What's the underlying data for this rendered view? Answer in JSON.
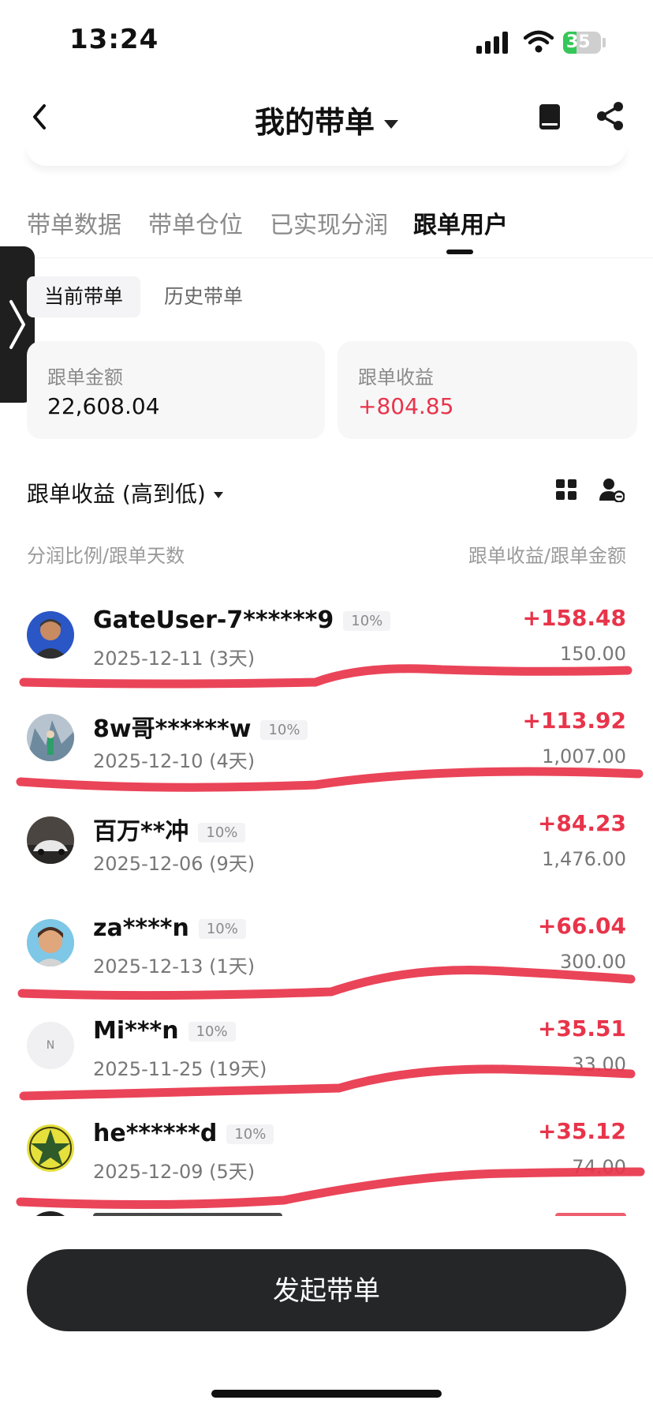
{
  "status_bar": {
    "time": "13:24",
    "battery": "35"
  },
  "nav": {
    "title": "我的带单"
  },
  "tabs": [
    {
      "label": "带单数据",
      "active": false
    },
    {
      "label": "带单仓位",
      "active": false
    },
    {
      "label": "已实现分润",
      "active": false
    },
    {
      "label": "跟单用户",
      "active": true
    }
  ],
  "segments": {
    "current": "当前带单",
    "history": "历史带单"
  },
  "summary": {
    "amount_label": "跟单金额",
    "amount_value": "22,608.04",
    "profit_label": "跟单收益",
    "profit_value": "+804.85"
  },
  "sort": {
    "label": "跟单收益 (高到低)"
  },
  "columns": {
    "left": "分润比例/跟单天数",
    "right": "跟单收益/跟单金额"
  },
  "followers": [
    {
      "name": "GateUser-7******9",
      "ratio": "10%",
      "date": "2025-12-11 (3天)",
      "profit": "+158.48",
      "amount": "150.00"
    },
    {
      "name": "8w哥******w",
      "ratio": "10%",
      "date": "2025-12-10 (4天)",
      "profit": "+113.92",
      "amount": "1,007.00"
    },
    {
      "name": "百万**冲",
      "ratio": "10%",
      "date": "2025-12-06 (9天)",
      "profit": "+84.23",
      "amount": "1,476.00"
    },
    {
      "name": "za****n",
      "ratio": "10%",
      "date": "2025-12-13 (1天)",
      "profit": "+66.04",
      "amount": "300.00"
    },
    {
      "name": "Mi***n",
      "ratio": "10%",
      "date": "2025-11-25 (19天)",
      "profit": "+35.51",
      "amount": "33.00",
      "avatar_letter": "N"
    },
    {
      "name": "he******d",
      "ratio": "10%",
      "date": "2025-12-09 (5天)",
      "profit": "+35.12",
      "amount": "74.00"
    }
  ],
  "button": {
    "label": "发起带单"
  },
  "colors": {
    "positive": "#e8344a",
    "button_bg": "#252628",
    "annotation": "#e8344a"
  }
}
